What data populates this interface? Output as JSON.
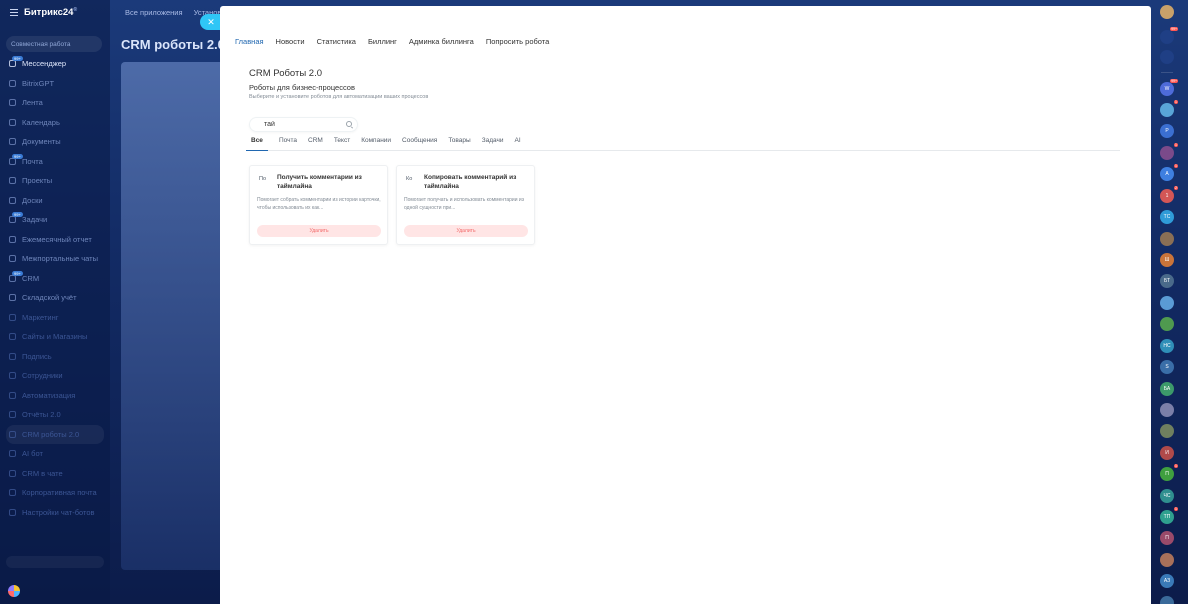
{
  "app": {
    "logo": "Битрикс24",
    "logo_sup": "®"
  },
  "sidebar": {
    "top_button": "Совместная работа",
    "items": [
      {
        "label": "Мессенджер",
        "badge": "99+",
        "style": "bright"
      },
      {
        "label": "BitrixGPT",
        "badge": "",
        "style": "dim"
      },
      {
        "label": "Лента",
        "badge": "",
        "style": "dim"
      },
      {
        "label": "Календарь",
        "badge": "",
        "style": "dim"
      },
      {
        "label": "Документы",
        "badge": "",
        "style": "dim"
      },
      {
        "label": "Почта",
        "badge": "99+",
        "style": "dim"
      },
      {
        "label": "Проекты",
        "badge": "",
        "style": "dim"
      },
      {
        "label": "Доски",
        "badge": "",
        "style": "dim"
      },
      {
        "label": "Задачи",
        "badge": "99+",
        "style": "dim"
      },
      {
        "label": "Ежемесячный отчет",
        "badge": "",
        "style": "dim"
      },
      {
        "label": "Межпортальные чаты",
        "badge": "",
        "style": "dim"
      },
      {
        "label": "CRM",
        "badge": "99+",
        "style": "dim"
      },
      {
        "label": "Складской учёт",
        "badge": "",
        "style": "dim"
      },
      {
        "label": "Маркетинг",
        "badge": "",
        "style": "faint"
      },
      {
        "label": "Сайты и Магазины",
        "badge": "",
        "style": "faint"
      },
      {
        "label": "Подпись",
        "badge": "",
        "style": "faint"
      },
      {
        "label": "Сотрудники",
        "badge": "",
        "style": "faint"
      },
      {
        "label": "Автоматизация",
        "badge": "",
        "style": "faint"
      },
      {
        "label": "Отчёты 2.0",
        "badge": "",
        "style": "faint"
      },
      {
        "label": "CRM роботы 2.0",
        "badge": "",
        "style": "faint",
        "active": true
      },
      {
        "label": "AI бот",
        "badge": "",
        "style": "faint"
      },
      {
        "label": "CRM в чате",
        "badge": "",
        "style": "faint"
      },
      {
        "label": "Корпоративная почта",
        "badge": "",
        "style": "faint"
      },
      {
        "label": "Настройки чат-ботов",
        "badge": "",
        "style": "faint"
      }
    ]
  },
  "topnav": {
    "items": [
      "Все приложения",
      "Установ..."
    ]
  },
  "page": {
    "title": "CRM роботы 2.0"
  },
  "panel": {
    "tabs": [
      "Главная",
      "Новости",
      "Статистика",
      "Биллинг",
      "Админка биллинга",
      "Попросить робота"
    ],
    "active_tab": "Главная",
    "title": "CRM Роботы 2.0",
    "subtitle": "Роботы для бизнес-процессов",
    "description": "Выберите и установите роботов для автоматизации ваших процессов",
    "search_value": "тай",
    "filters": [
      "Все",
      "Почта",
      "CRM",
      "Текст",
      "Компании",
      "Сообщения",
      "Товары",
      "Задачи",
      "AI"
    ],
    "active_filter": "Все",
    "cards": [
      {
        "icon_text": "По",
        "title": "Получить комментарии из таймлайна",
        "description": "Помогает собрать комментарии из истории карточки, чтобы использовать их как...",
        "button": "Удалить"
      },
      {
        "icon_text": "Ко",
        "title": "Копировать комментарий из таймлайна",
        "description": "Помогает получать и использовать комментарии из одной сущности при...",
        "button": "Удалить"
      }
    ]
  },
  "rightbar": {
    "items": [
      {
        "icon": "user-avatar",
        "label": "",
        "badge": "",
        "color": "#c8a16a"
      },
      {
        "icon": "bell-icon",
        "label": "",
        "badge": "99+",
        "color": "#1f3f85"
      },
      {
        "icon": "chat-icon",
        "label": "",
        "badge": "",
        "color": "#1f3f85"
      },
      {
        "icon": "chat-avatar",
        "label": "W",
        "badge": "99+",
        "color": "#4e6bd9"
      },
      {
        "icon": "chat-avatar",
        "label": "",
        "badge": "1",
        "color": "#59a5d8"
      },
      {
        "icon": "chat-avatar",
        "label": "Р",
        "badge": "",
        "color": "#3b6fd1"
      },
      {
        "icon": "chat-avatar",
        "label": "",
        "badge": "1",
        "color": "#7a4a8a"
      },
      {
        "icon": "chat-avatar",
        "label": "А",
        "badge": "1",
        "color": "#3e7fe0"
      },
      {
        "icon": "chat-avatar",
        "label": "1",
        "badge": "2",
        "color": "#d35656"
      },
      {
        "icon": "chat-avatar",
        "label": "ТС",
        "badge": "",
        "color": "#2f9bd8"
      },
      {
        "icon": "chat-avatar",
        "label": "",
        "badge": "",
        "color": "#8a6f55"
      },
      {
        "icon": "chat-avatar",
        "label": "Ш",
        "badge": "",
        "color": "#c9743a"
      },
      {
        "icon": "chat-avatar",
        "label": "БТ",
        "badge": "",
        "color": "#4a6a8a"
      },
      {
        "icon": "chat-avatar",
        "label": "",
        "badge": "",
        "color": "#5a9bd5"
      },
      {
        "icon": "chat-avatar",
        "label": "",
        "badge": "",
        "color": "#4f9a4f"
      },
      {
        "icon": "chat-avatar",
        "label": "НС",
        "badge": "",
        "color": "#2f8fb8"
      },
      {
        "icon": "chat-avatar",
        "label": "S",
        "badge": "",
        "color": "#3a6ea8"
      },
      {
        "icon": "chat-avatar",
        "label": "БА",
        "badge": "",
        "color": "#3c9a6a"
      },
      {
        "icon": "chat-avatar",
        "label": "",
        "badge": "",
        "color": "#7b7fa8"
      },
      {
        "icon": "chat-avatar",
        "label": "",
        "badge": "",
        "color": "#6f7f5f"
      },
      {
        "icon": "chat-avatar",
        "label": "И",
        "badge": "",
        "color": "#b04a4a"
      },
      {
        "icon": "chat-avatar",
        "label": "П",
        "badge": "1",
        "color": "#3f9f3f"
      },
      {
        "icon": "chat-avatar",
        "label": "ЧС",
        "badge": "",
        "color": "#2f8f8f"
      },
      {
        "icon": "chat-avatar",
        "label": "ТП",
        "badge": "1",
        "color": "#2fa08f"
      },
      {
        "icon": "chat-avatar",
        "label": "П",
        "badge": "",
        "color": "#9a4a6a"
      },
      {
        "icon": "chat-avatar",
        "label": "",
        "badge": "",
        "color": "#a8705a"
      },
      {
        "icon": "chat-avatar",
        "label": "АЗ",
        "badge": "",
        "color": "#3a7ab8"
      },
      {
        "icon": "chat-avatar",
        "label": "",
        "badge": "",
        "color": "#3a6a9a"
      }
    ]
  }
}
